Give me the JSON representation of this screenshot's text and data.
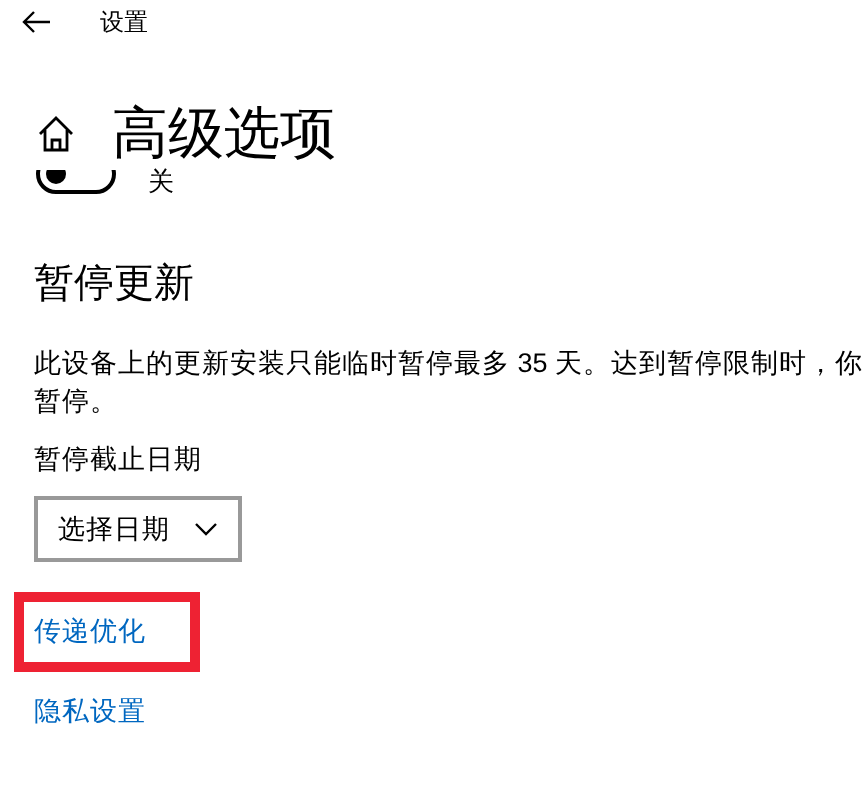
{
  "window": {
    "title": "设置"
  },
  "page": {
    "title": "高级选项"
  },
  "toggle": {
    "on": false,
    "label": "关"
  },
  "pause": {
    "heading": "暂停更新",
    "description_lines": [
      "此设备上的更新安装只能临时暂停最多 35 天。达到暂停限制时，你",
      "暂停。"
    ],
    "date_label": "暂停截止日期",
    "date_select": "选择日期"
  },
  "links": [
    {
      "label": "传递优化",
      "highlighted": true
    },
    {
      "label": "隐私设置",
      "highlighted": false
    }
  ]
}
